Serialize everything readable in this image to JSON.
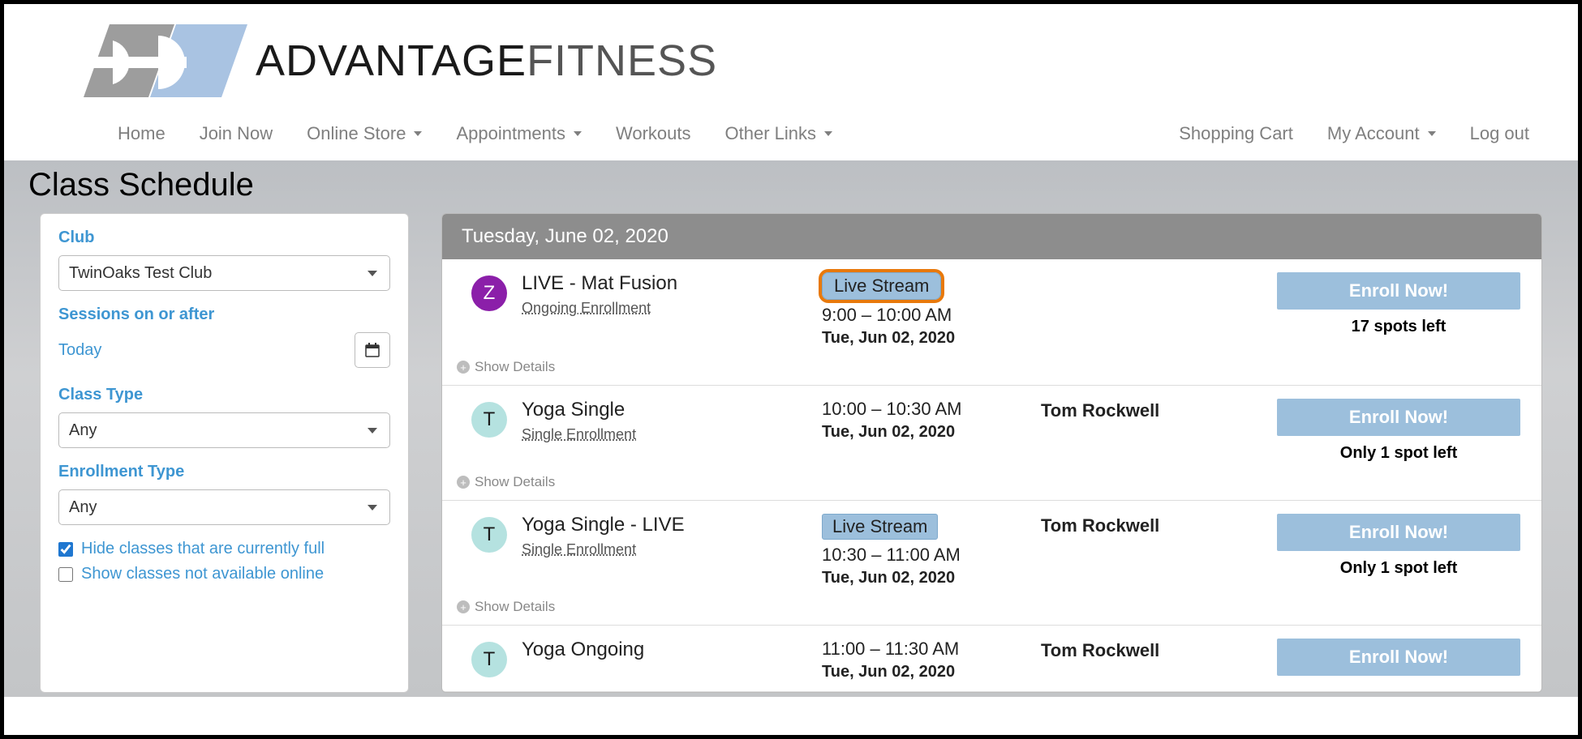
{
  "brand": {
    "name_bold": "ADVANTAGE",
    "name_light": "FITNESS"
  },
  "nav": {
    "left": [
      "Home",
      "Join Now",
      "Online Store",
      "Appointments",
      "Workouts",
      "Other Links"
    ],
    "left_has_caret": [
      false,
      false,
      true,
      true,
      false,
      true
    ],
    "right": [
      "Shopping Cart",
      "My Account",
      "Log out"
    ],
    "right_has_caret": [
      false,
      true,
      false
    ]
  },
  "page_title": "Class Schedule",
  "sidebar": {
    "club_label": "Club",
    "club_value": "TwinOaks Test Club",
    "sessions_label": "Sessions on or after",
    "today": "Today",
    "class_type_label": "Class Type",
    "class_type_value": "Any",
    "enroll_type_label": "Enrollment Type",
    "enroll_type_value": "Any",
    "hide_full_label": "Hide classes that are currently full",
    "hide_full_checked": true,
    "show_unavail_label": "Show classes not available online",
    "show_unavail_checked": false
  },
  "schedule": {
    "date_header": "Tuesday, June 02, 2020",
    "show_details": "Show Details",
    "events": [
      {
        "avatar": "Z",
        "avatar_style": "purple",
        "title": "LIVE - Mat Fusion",
        "enroll_type": "Ongoing Enrollment",
        "live_stream": true,
        "live_highlight": true,
        "time": "9:00 – 10:00 AM",
        "date": "Tue, Jun 02, 2020",
        "instructor": "",
        "enroll_label": "Enroll Now!",
        "spots": "17 spots left"
      },
      {
        "avatar": "T",
        "avatar_style": "teal",
        "title": "Yoga Single",
        "enroll_type": "Single Enrollment",
        "live_stream": false,
        "live_highlight": false,
        "time": "10:00 – 10:30 AM",
        "date": "Tue, Jun 02, 2020",
        "instructor": "Tom Rockwell",
        "enroll_label": "Enroll Now!",
        "spots": "Only 1 spot left"
      },
      {
        "avatar": "T",
        "avatar_style": "teal",
        "title": "Yoga Single - LIVE",
        "enroll_type": "Single Enrollment",
        "live_stream": true,
        "live_highlight": false,
        "time": "10:30 – 11:00 AM",
        "date": "Tue, Jun 02, 2020",
        "instructor": "Tom Rockwell",
        "enroll_label": "Enroll Now!",
        "spots": "Only 1 spot left"
      },
      {
        "avatar": "T",
        "avatar_style": "teal",
        "title": "Yoga Ongoing",
        "enroll_type": "",
        "live_stream": false,
        "live_highlight": false,
        "time": "11:00 – 11:30 AM",
        "date": "Tue, Jun 02, 2020",
        "instructor": "Tom Rockwell",
        "enroll_label": "Enroll Now!",
        "spots": ""
      }
    ],
    "live_stream_label": "Live Stream"
  }
}
